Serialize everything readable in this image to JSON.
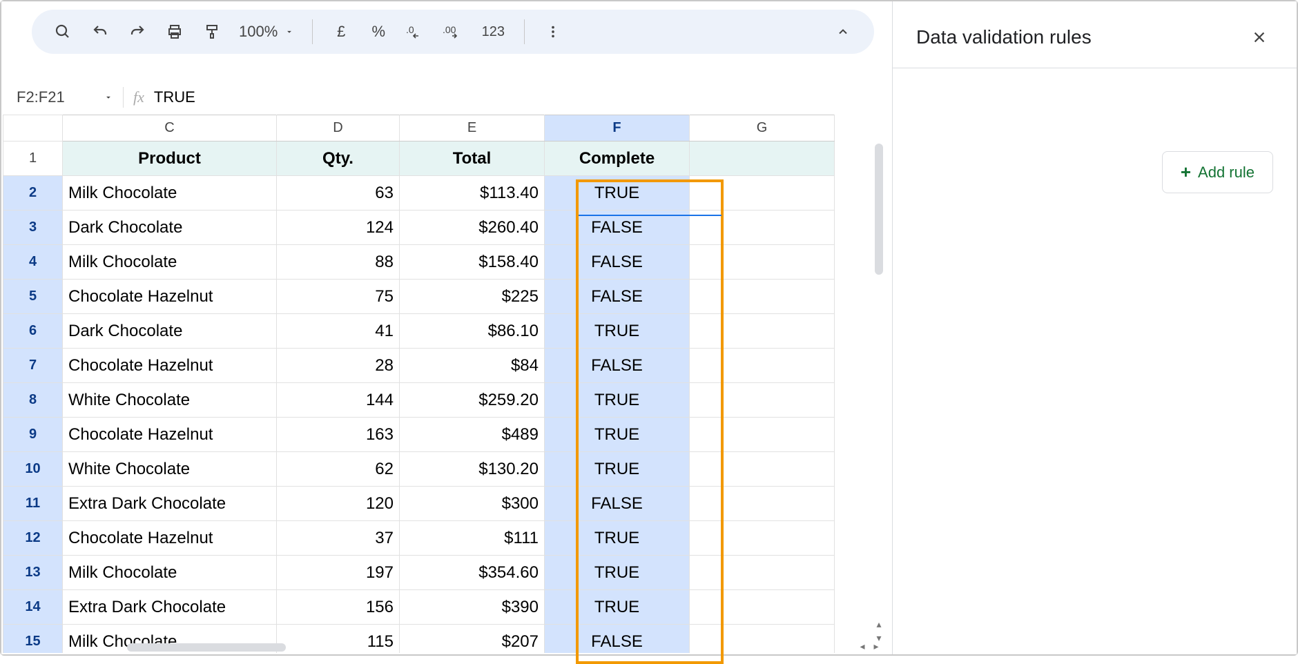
{
  "toolbar": {
    "zoom": "100%",
    "currency": "£",
    "percent": "%",
    "numfmt": "123"
  },
  "namebox": {
    "range": "F2:F21",
    "formula": "TRUE"
  },
  "columns": [
    "C",
    "D",
    "E",
    "F",
    "G"
  ],
  "headers": {
    "product": "Product",
    "qty": "Qty.",
    "total": "Total",
    "complete": "Complete"
  },
  "rows": [
    {
      "n": 2,
      "product": "Milk Chocolate",
      "qty": 63,
      "total": "$113.40",
      "complete": "TRUE"
    },
    {
      "n": 3,
      "product": "Dark Chocolate",
      "qty": 124,
      "total": "$260.40",
      "complete": "FALSE"
    },
    {
      "n": 4,
      "product": "Milk Chocolate",
      "qty": 88,
      "total": "$158.40",
      "complete": "FALSE"
    },
    {
      "n": 5,
      "product": "Chocolate Hazelnut",
      "qty": 75,
      "total": "$225",
      "complete": "FALSE"
    },
    {
      "n": 6,
      "product": "Dark Chocolate",
      "qty": 41,
      "total": "$86.10",
      "complete": "TRUE"
    },
    {
      "n": 7,
      "product": "Chocolate Hazelnut",
      "qty": 28,
      "total": "$84",
      "complete": "FALSE"
    },
    {
      "n": 8,
      "product": "White Chocolate",
      "qty": 144,
      "total": "$259.20",
      "complete": "TRUE"
    },
    {
      "n": 9,
      "product": "Chocolate Hazelnut",
      "qty": 163,
      "total": "$489",
      "complete": "TRUE"
    },
    {
      "n": 10,
      "product": "White Chocolate",
      "qty": 62,
      "total": "$130.20",
      "complete": "TRUE"
    },
    {
      "n": 11,
      "product": "Extra Dark Chocolate",
      "qty": 120,
      "total": "$300",
      "complete": "FALSE"
    },
    {
      "n": 12,
      "product": "Chocolate Hazelnut",
      "qty": 37,
      "total": "$111",
      "complete": "TRUE"
    },
    {
      "n": 13,
      "product": "Milk Chocolate",
      "qty": 197,
      "total": "$354.60",
      "complete": "TRUE"
    },
    {
      "n": 14,
      "product": "Extra Dark Chocolate",
      "qty": 156,
      "total": "$390",
      "complete": "TRUE"
    },
    {
      "n": 15,
      "product": "Milk Chocolate",
      "qty": 115,
      "total": "$207",
      "complete": "FALSE"
    }
  ],
  "sidepanel": {
    "title": "Data validation rules",
    "add_rule": "Add rule"
  }
}
